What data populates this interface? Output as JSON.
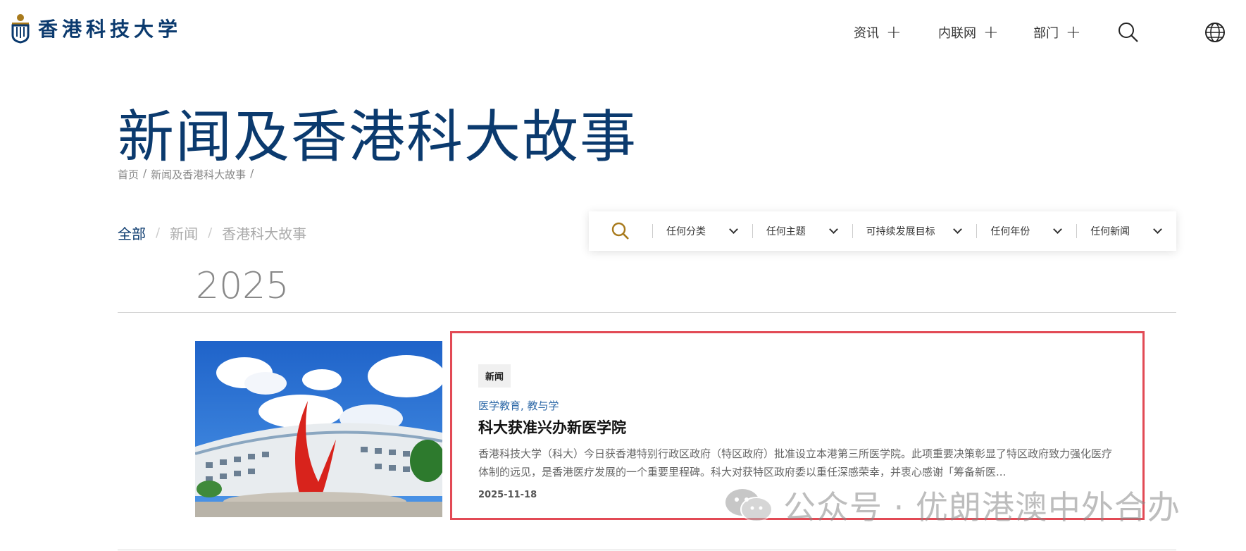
{
  "header": {
    "logo_text": "香港科技大学",
    "nav": [
      {
        "label": "资讯"
      },
      {
        "label": "内联网"
      },
      {
        "label": "部门"
      }
    ]
  },
  "page": {
    "title": "新闻及香港科大故事",
    "breadcrumb": [
      "首页",
      "新闻及香港科大故事"
    ]
  },
  "tabs": [
    {
      "label": "全部",
      "active": true
    },
    {
      "label": "新闻",
      "active": false
    },
    {
      "label": "香港科大故事",
      "active": false
    }
  ],
  "filters": [
    "任何分类",
    "任何主题",
    "可持续发展目标",
    "任何年份",
    "任何新闻"
  ],
  "year": "2025",
  "article": {
    "badge": "新闻",
    "tags": "医学教育, 教与学",
    "title": "科大获准兴办新医学院",
    "excerpt": "香港科技大学（科大）今日获香港特别行政区政府（特区政府）批准设立本港第三所医学院。此项重要决策彰显了特区政府致力强化医疗体制的远见，是香港医疗发展的一个重要里程碑。科大对获特区政府委以重任深感荣幸，并衷心感谢「筹备新医...",
    "date": "2025-11-18"
  },
  "watermark": "公众号 · 优朗港澳中外合办",
  "colors": {
    "brand": "#0b3a6e",
    "accent_gold": "#a87a1c",
    "highlight_border": "#e24a55",
    "tag": "#2f6aa8"
  }
}
